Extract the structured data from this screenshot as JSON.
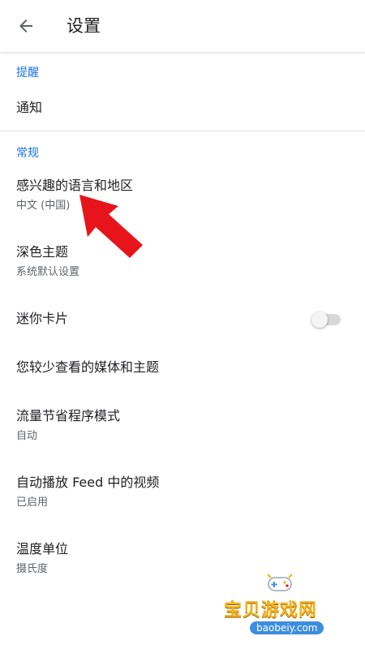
{
  "header": {
    "title": "设置",
    "back_icon": "arrow-back-icon"
  },
  "sections": {
    "reminders": {
      "label": "提醒",
      "items": {
        "notifications": {
          "title": "通知"
        }
      }
    },
    "general": {
      "label": "常规",
      "items": {
        "language_region": {
          "title": "感兴趣的语言和地区",
          "subtitle": "中文 (中国)"
        },
        "dark_theme": {
          "title": "深色主题",
          "subtitle": "系统默认设置"
        },
        "mini_cards": {
          "title": "迷你卡片",
          "toggle_on": false
        },
        "less_seen": {
          "title": "您较少查看的媒体和主题"
        },
        "data_saver": {
          "title": "流量节省程序模式",
          "subtitle": "自动"
        },
        "autoplay": {
          "title": "自动播放 Feed 中的视频",
          "subtitle": "已启用"
        },
        "temperature_unit": {
          "title": "温度单位",
          "subtitle": "摄氏度"
        }
      }
    }
  },
  "annotation": {
    "arrow_icon": "red-arrow-icon",
    "color": "#e8141c"
  },
  "watermark": {
    "title": "宝贝游戏网",
    "url": "baobeiy.com"
  },
  "colors": {
    "accent": "#1a73e8",
    "primary_text": "#202124",
    "secondary_text": "#5f6368",
    "divider": "#e0e0e0"
  }
}
